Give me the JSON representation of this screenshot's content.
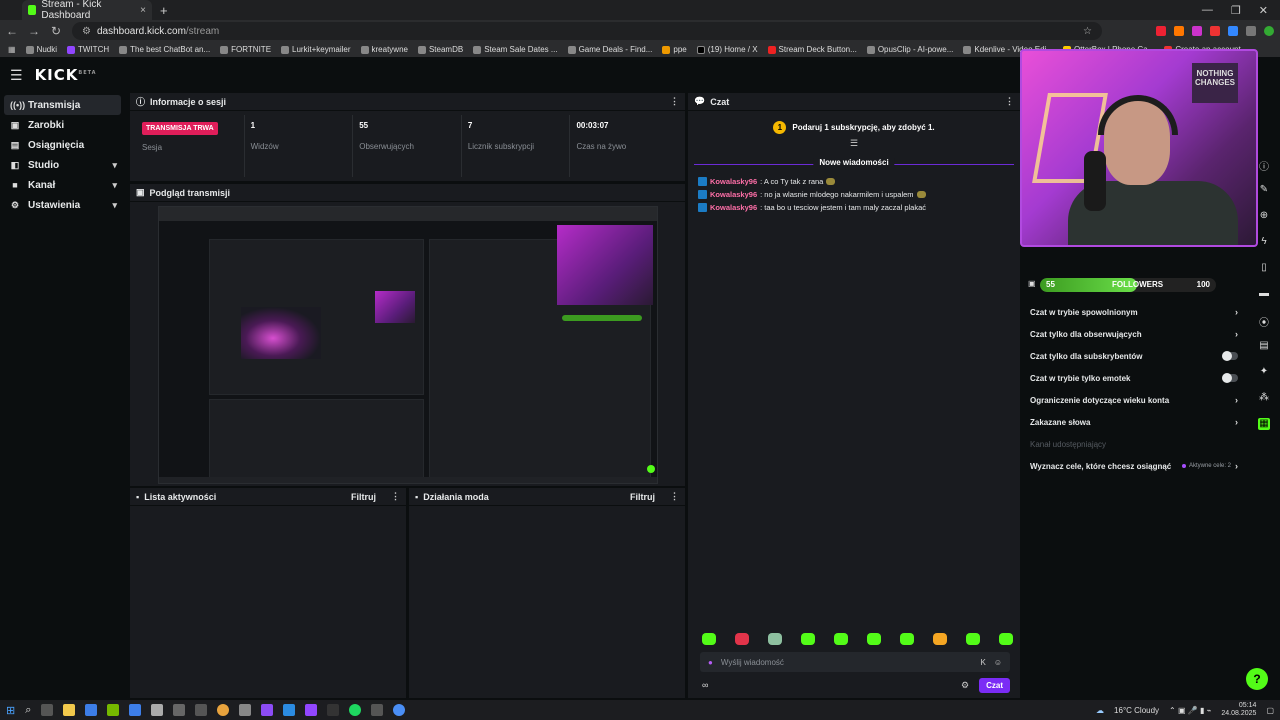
{
  "browser": {
    "tab_title": "Stream - Kick Dashboard",
    "url_host": "dashboard.kick.com",
    "url_path": "/stream",
    "bookmarks": [
      "Nudki",
      "TWITCH",
      "The best ChatBot an...",
      "FORTNITE",
      "Lurkit+keymailer",
      "kreatywne",
      "SteamDB",
      "Steam Sale Dates ...",
      "Game Deals - Find...",
      "ppe",
      "(19) Home / X",
      "Stream Deck Button...",
      "OpusClip - AI-powe...",
      "Kdenlive - Video Edi...",
      "OtterBox | Phone Ca...",
      "Create an account -..."
    ]
  },
  "app": {
    "logo": "KICK",
    "logo_sup": "BETA"
  },
  "sidebar": {
    "items": [
      {
        "label": "Transmisja",
        "icon": "broadcast-icon"
      },
      {
        "label": "Zarobki",
        "icon": "wallet-icon"
      },
      {
        "label": "Osiągnięcia",
        "icon": "trophy-icon"
      },
      {
        "label": "Studio",
        "icon": "studio-icon"
      },
      {
        "label": "Kanał",
        "icon": "channel-icon"
      },
      {
        "label": "Ustawienia",
        "icon": "gear-icon"
      }
    ]
  },
  "session": {
    "title": "Informacje o sesji",
    "live_badge": "TRANSMISJA TRWA",
    "session_label": "Sesja",
    "stats": [
      {
        "value": "1",
        "label": "Widzów"
      },
      {
        "value": "55",
        "label": "Obserwujących"
      },
      {
        "value": "7",
        "label": "Licznik subskrypcji"
      },
      {
        "value": "00:03:07",
        "label": "Czas na żywo"
      }
    ]
  },
  "preview": {
    "title": "Podgląd transmisji"
  },
  "activity": {
    "title": "Lista aktywności",
    "filter": "Filtruj"
  },
  "modactions": {
    "title": "Działania moda",
    "filter": "Filtruj"
  },
  "chat": {
    "title": "Czat",
    "promo_coin": "1",
    "promo": "Podaruj 1 subskrypcję, aby zdobyć 1.",
    "new_messages": "Nowe wiadomości",
    "messages": [
      {
        "user": "Kowalasky96",
        "text": ": A co Ty tak z rana"
      },
      {
        "user": "Kowalasky96",
        "text": ": no ja wlasnie mlodego nakarmilem i uspalem"
      },
      {
        "user": "Kowalasky96",
        "text": ": taa bo u tesciow jestem i tam maly zaczal plakać"
      }
    ],
    "input_placeholder": "Wyślij wiadomość",
    "bottom_left": "∞",
    "send": "Czat"
  },
  "settings": {
    "followers_from": "55",
    "followers_label": "FOLLOWERS",
    "followers_to": "100",
    "followers_progress": 0.55,
    "rows": [
      {
        "label": "Czat w trybie spowolnionym",
        "type": "chevron"
      },
      {
        "label": "Czat tylko dla obserwujących",
        "type": "chevron"
      },
      {
        "label": "Czat tylko dla subskrybentów",
        "type": "toggle"
      },
      {
        "label": "Czat w trybie tylko emotek",
        "type": "toggle"
      },
      {
        "label": "Ograniczenie dotyczące wieku konta",
        "type": "chevron"
      },
      {
        "label": "Zakazane słowa",
        "type": "chevron"
      },
      {
        "label": "Kanał udostępniający",
        "type": "muted"
      }
    ],
    "goals_label": "Wyznacz cele, które chcesz osiągnąć",
    "goals_active": "Aktywne cele: 2"
  },
  "webcam": {
    "sign": "NOTHING CHANGES"
  },
  "taskbar": {
    "weather": "16°C  Cloudy",
    "time": "05:14",
    "date": "24.08.2025"
  },
  "colors": {
    "brand": "#53fc18",
    "live": "#e01e5a",
    "accent": "#7b2cf5"
  }
}
